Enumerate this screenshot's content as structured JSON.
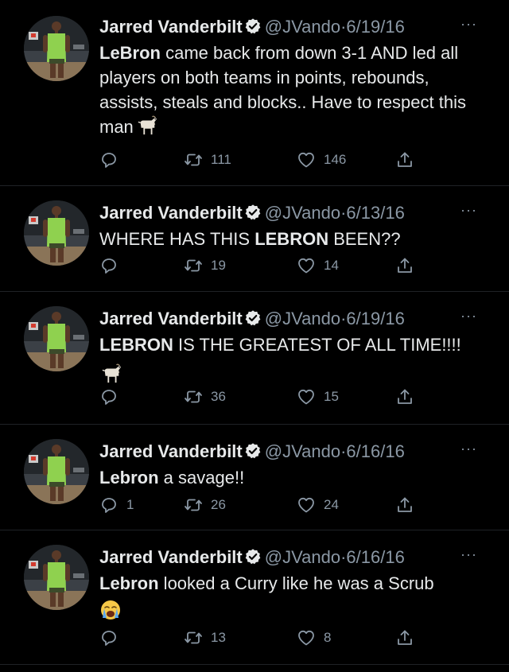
{
  "tweets": [
    {
      "author": "Jarred Vanderbilt",
      "handle": "@JVando",
      "separator": "·",
      "date": "6/19/16",
      "text_segments": [
        {
          "text": "LeBron",
          "bold": true
        },
        {
          "text": " came back from down 3-1 AND led all players on both teams in points, rebounds, assists, steals and blocks.. Have to respect this man",
          "bold": false
        }
      ],
      "emoji": "goat-emoji",
      "replies": "",
      "retweets": "111",
      "likes": "146"
    },
    {
      "author": "Jarred Vanderbilt",
      "handle": "@JVando",
      "separator": "·",
      "date": "6/13/16",
      "text_segments": [
        {
          "text": "WHERE HAS THIS ",
          "bold": false
        },
        {
          "text": "LEBRON",
          "bold": true
        },
        {
          "text": " BEEN??",
          "bold": false
        }
      ],
      "replies": "",
      "retweets": "19",
      "likes": "14"
    },
    {
      "author": "Jarred Vanderbilt",
      "handle": "@JVando",
      "separator": "·",
      "date": "6/19/16",
      "text_segments": [
        {
          "text": "LEBRON",
          "bold": true
        },
        {
          "text": " IS THE GREATEST OF ALL TIME!!!!",
          "bold": false
        }
      ],
      "emoji": "goat-emoji",
      "replies": "",
      "retweets": "36",
      "likes": "15"
    },
    {
      "author": "Jarred Vanderbilt",
      "handle": "@JVando",
      "separator": "·",
      "date": "6/16/16",
      "text_segments": [
        {
          "text": "Lebron",
          "bold": true
        },
        {
          "text": " a savage!!",
          "bold": false
        }
      ],
      "replies": "1",
      "retweets": "26",
      "likes": "24"
    },
    {
      "author": "Jarred Vanderbilt",
      "handle": "@JVando",
      "separator": "·",
      "date": "6/16/16",
      "text_segments": [
        {
          "text": "Lebron",
          "bold": true
        },
        {
          "text": " looked a Curry like he was a Scrub",
          "bold": false
        }
      ],
      "emoji": "loudly-crying-face-emoji",
      "replies": "",
      "retweets": "13",
      "likes": "8"
    }
  ],
  "more_label": "···",
  "icons": {
    "verified": "verified-badge-icon",
    "reply": "reply-icon",
    "retweet": "retweet-icon",
    "like": "heart-icon",
    "share": "share-icon",
    "more": "more-icon"
  },
  "colors": {
    "background": "#000000",
    "text": "#e7e9ea",
    "secondary": "#8b98a5",
    "divider": "#1f2226",
    "jersey": "#8fd14f"
  }
}
